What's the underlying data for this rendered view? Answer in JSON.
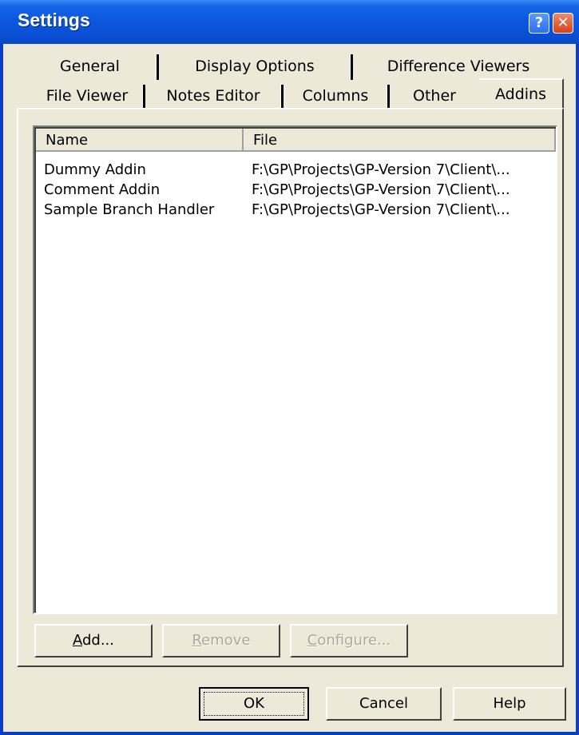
{
  "window": {
    "title": "Settings",
    "help_glyph": "?",
    "close_glyph": "✕"
  },
  "tabs": {
    "row1": [
      "General",
      "Display Options",
      "Difference Viewers"
    ],
    "row2": [
      "File Viewer",
      "Notes Editor",
      "Columns",
      "Other",
      "Addins"
    ],
    "active": "Addins"
  },
  "list": {
    "columns": [
      "Name",
      "File"
    ],
    "rows": [
      {
        "name": "Dummy Addin",
        "file": "F:\\GP\\Projects\\GP-Version 7\\Client\\..."
      },
      {
        "name": "Comment Addin",
        "file": "F:\\GP\\Projects\\GP-Version 7\\Client\\..."
      },
      {
        "name": "Sample Branch Handler",
        "file": "F:\\GP\\Projects\\GP-Version 7\\Client\\..."
      }
    ]
  },
  "panel_buttons": {
    "add_label_u": "A",
    "add_label_rest": "dd...",
    "remove_label_u": "R",
    "remove_label_rest": "emove",
    "configure_label_u": "C",
    "configure_label_rest": "onfigure..."
  },
  "dialog_buttons": {
    "ok": "OK",
    "cancel": "Cancel",
    "help": "Help"
  }
}
